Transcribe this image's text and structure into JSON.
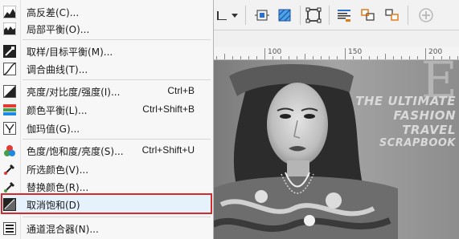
{
  "menu": {
    "items": [
      {
        "label": "高反差(C)...",
        "shortcut": "",
        "icon": "high-contrast-icon"
      },
      {
        "label": "局部平衡(O)...",
        "shortcut": "",
        "icon": "local-equalization-icon"
      },
      {
        "label": "取样/目标平衡(M)...",
        "shortcut": "",
        "icon": "sample-target-icon"
      },
      {
        "label": "调合曲线(T)...",
        "shortcut": "",
        "icon": "tone-curve-icon"
      },
      {
        "label": "亮度/对比度/强度(I)...",
        "shortcut": "Ctrl+B",
        "icon": "brightness-contrast-icon"
      },
      {
        "label": "颜色平衡(L)...",
        "shortcut": "Ctrl+Shift+B",
        "icon": "color-balance-icon"
      },
      {
        "label": "伽玛值(G)...",
        "shortcut": "",
        "icon": "gamma-icon"
      },
      {
        "label": "色度/饱和度/亮度(S)...",
        "shortcut": "Ctrl+Shift+U",
        "icon": "hue-saturation-icon"
      },
      {
        "label": "所选颜色(V)...",
        "shortcut": "",
        "icon": "selective-color-icon"
      },
      {
        "label": "替换颜色(R)...",
        "shortcut": "",
        "icon": "replace-color-icon"
      },
      {
        "label": "取消饱和(D)",
        "shortcut": "",
        "icon": "desaturate-icon"
      },
      {
        "label": "通道混合器(N)...",
        "shortcut": "",
        "icon": "channel-mixer-icon"
      }
    ]
  },
  "ruler": {
    "labels": [
      "100",
      "150",
      "200"
    ]
  },
  "canvas": {
    "magazine_logo": "E",
    "headline_lines": [
      "THE ULTIMATE",
      "FASHION",
      "TRAVEL",
      "SCRAPBOOK"
    ]
  },
  "colors": {
    "highlight_border": "#d42a2a",
    "highlight_bg": "#e5f1fb"
  }
}
